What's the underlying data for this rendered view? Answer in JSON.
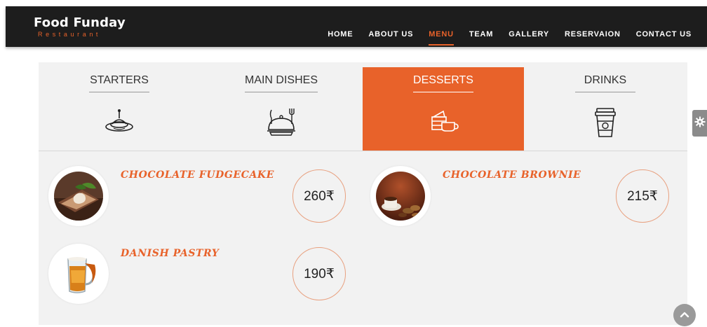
{
  "brand": {
    "name": "Food Funday",
    "subtitle": "Restaurant"
  },
  "nav": {
    "items": [
      {
        "label": "HOME"
      },
      {
        "label": "ABOUT US"
      },
      {
        "label": "MENU",
        "active": true
      },
      {
        "label": "TEAM"
      },
      {
        "label": "GALLERY"
      },
      {
        "label": "RESERVAION"
      },
      {
        "label": "CONTACT US"
      }
    ]
  },
  "menu": {
    "tabs": [
      {
        "label": "STARTERS",
        "icon": "starter-dish-icon"
      },
      {
        "label": "MAIN DISHES",
        "icon": "main-dish-icon"
      },
      {
        "label": "DESSERTS",
        "icon": "dessert-cup-icon",
        "active": true
      },
      {
        "label": "DRINKS",
        "icon": "drink-cup-icon"
      }
    ],
    "items": [
      {
        "name": "CHOCOLATE FUDGECAKE",
        "price": "260₹"
      },
      {
        "name": "CHOCOLATE BROWNIE",
        "price": "215₹"
      },
      {
        "name": "DANISH PASTRY",
        "price": "190₹"
      }
    ]
  },
  "colors": {
    "accent": "#e8622a",
    "navbar": "#1d1d1d",
    "panel": "#f2f2f2"
  },
  "widgets": {
    "settings_icon": "gear-icon",
    "scroll_icon": "chevron-up-icon"
  }
}
